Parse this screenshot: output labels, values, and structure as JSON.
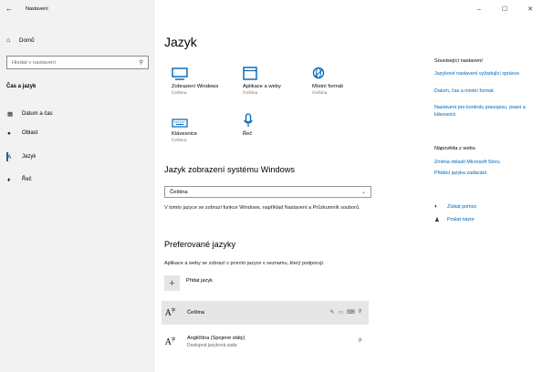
{
  "window": {
    "title": "Nastavení",
    "minimize": "–",
    "maximize": "☐",
    "close": "✕"
  },
  "sidebar": {
    "home": "Domů",
    "search_placeholder": "Hledat v nastavení",
    "section": "Čas a jazyk",
    "items": [
      {
        "label": "Datum a čas",
        "icon": "calendar-clock-icon"
      },
      {
        "label": "Oblast",
        "icon": "globe-icon"
      },
      {
        "label": "Jazyk",
        "icon": "language-icon"
      },
      {
        "label": "Řeč",
        "icon": "microphone-icon"
      }
    ]
  },
  "main": {
    "title": "Jazyk",
    "tiles": [
      {
        "label": "Zobrazení Windows",
        "sub": "Čeština",
        "icon": "monitor-icon"
      },
      {
        "label": "Aplikace a weby",
        "sub": "Čeština",
        "icon": "browser-window-icon"
      },
      {
        "label": "Místní formát",
        "sub": "Čeština",
        "icon": "globe-settings-icon"
      },
      {
        "label": "Klávesnice",
        "sub": "Čeština",
        "icon": "keyboard-icon"
      },
      {
        "label": "Řeč",
        "sub": "",
        "icon": "microphone-icon"
      }
    ],
    "display_language_heading": "Jazyk zobrazení systému Windows",
    "display_language_value": "Čeština",
    "display_language_note": "V tomto jazyce se zobrazí funkce Windows, například Nastavení a Průzkumník souborů.",
    "preferred_heading": "Preferované jazyky",
    "preferred_note": "Aplikace a weby se zobrazí v prvním jazyce v seznamu, který podporují.",
    "add_language": "Přidat jazyk",
    "languages": [
      {
        "name": "Čeština",
        "sub": ""
      },
      {
        "name": "Angličtina (Spojené státy)",
        "sub": "Dostupná jazyková sada"
      }
    ]
  },
  "right": {
    "related_title": "Související nastavení",
    "related_links": [
      "Jazykové nastavení vyžadující správce",
      "Datum, čas a místní formát",
      "Nastavení pro kontrolu pravopisu, psaní a klávesnici"
    ],
    "help_title": "Nápověda z webu",
    "help_links": [
      "Změna oblasti Microsoft Storu",
      "Přidání jazyka zadávání"
    ],
    "get_help": "Získat pomoc",
    "feedback": "Poslat názor"
  }
}
